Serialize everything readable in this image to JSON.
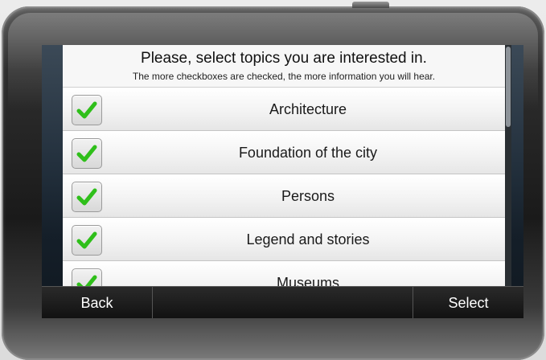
{
  "dialog": {
    "title": "Please, select topics you are interested in.",
    "subtitle": "The more checkboxes are checked, the more information you will hear."
  },
  "topics": [
    {
      "label": "Architecture",
      "checked": true
    },
    {
      "label": "Foundation of the city",
      "checked": true
    },
    {
      "label": "Persons",
      "checked": true
    },
    {
      "label": "Legend and stories",
      "checked": true
    },
    {
      "label": "Museums",
      "checked": true
    }
  ],
  "bottom_bar": {
    "back_label": "Back",
    "middle_label": "",
    "select_label": "Select"
  },
  "colors": {
    "check_green": "#2fbf1a",
    "panel_bg": "#f4f4f4",
    "bar_bg": "#111111"
  },
  "icons": {
    "check": "checkmark-icon"
  }
}
